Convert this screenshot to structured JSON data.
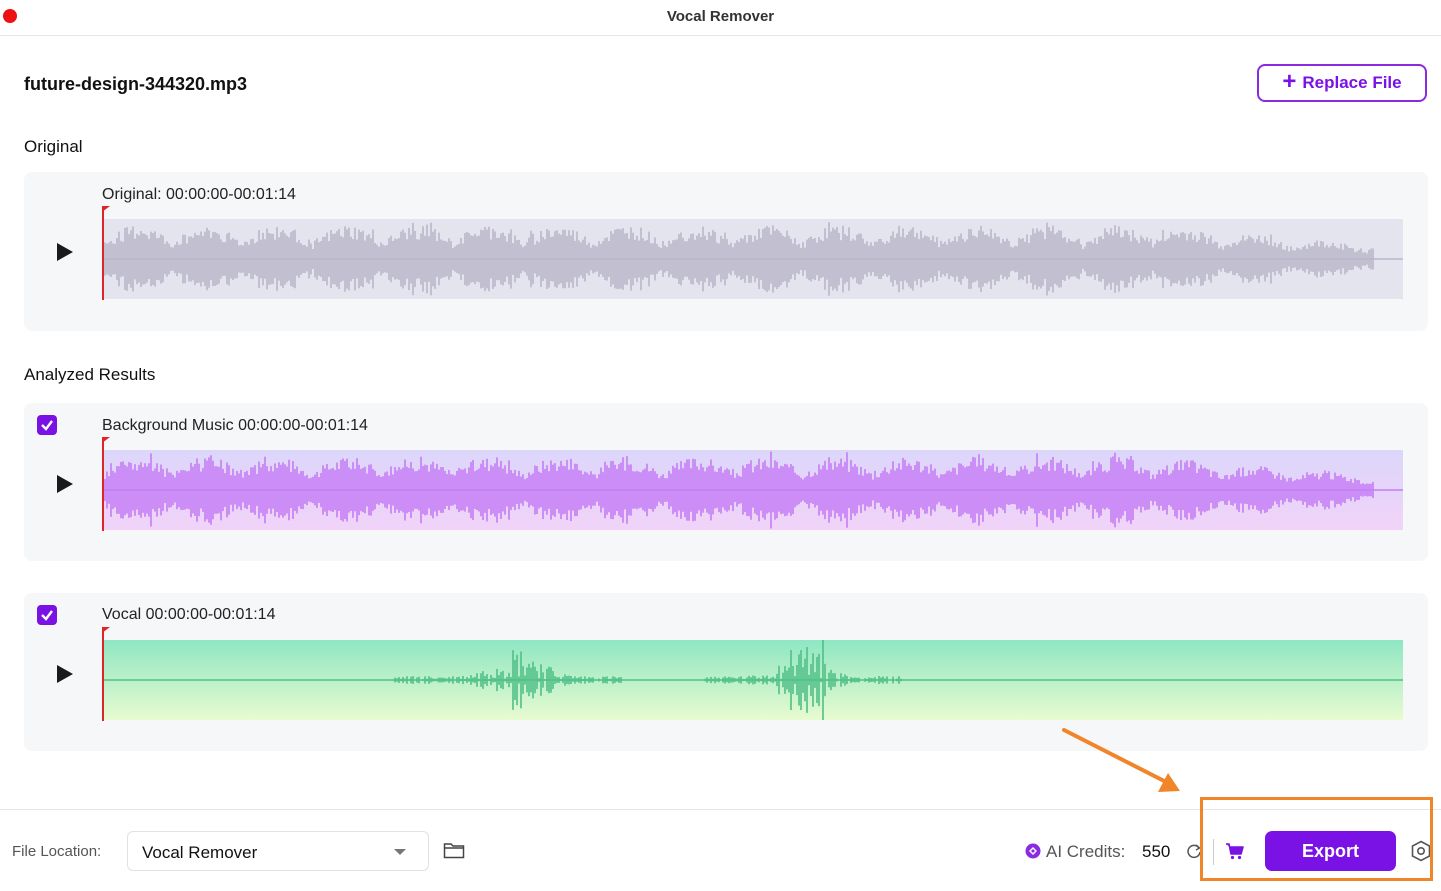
{
  "window": {
    "title": "Vocal Remover"
  },
  "file": {
    "name": "future-design-344320.mp3",
    "replace_label": "Replace File"
  },
  "sections": {
    "original": "Original",
    "analyzed": "Analyzed Results"
  },
  "tracks": [
    {
      "id": "original",
      "label": "Original: 00:00:00-00:01:14",
      "has_checkbox": false,
      "checked": false,
      "color": "#b9b6c9",
      "bg": "#e4e4ee"
    },
    {
      "id": "background",
      "label": "Background Music 00:00:00-00:01:14",
      "has_checkbox": true,
      "checked": true,
      "color": "#c47df5",
      "bg_top": "#dcd6fb",
      "bg_bottom": "#f1d3f8"
    },
    {
      "id": "vocal",
      "label": "Vocal 00:00:00-00:01:14",
      "has_checkbox": true,
      "checked": true,
      "color": "#4fbf88",
      "bg_top": "#8fe6c3",
      "bg_bottom": "#e8fbd0"
    }
  ],
  "footer": {
    "file_location_label": "File Location:",
    "file_location_value": "Vocal Remover",
    "credits_label": "AI Credits:",
    "credits_value": "550",
    "export_label": "Export"
  },
  "colors": {
    "accent": "#7a12e6",
    "playhead": "#e0242c",
    "highlight": "#f0852a"
  },
  "icons": [
    "close-dot",
    "plus-icon",
    "play-icon",
    "checkbox-icon",
    "folder-icon",
    "credits-icon",
    "refresh-icon",
    "cart-icon",
    "settings-icon"
  ]
}
